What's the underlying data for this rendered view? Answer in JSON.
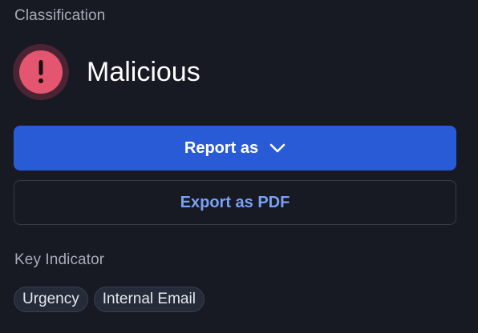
{
  "classification": {
    "label": "Classification",
    "value": "Malicious",
    "icon": "alert-circle-icon",
    "status_color": "#e4566f"
  },
  "actions": {
    "report_label": "Report as",
    "report_icon": "chevron-down-icon",
    "export_label": "Export as PDF"
  },
  "key_indicator": {
    "label": "Key Indicator",
    "tags": [
      "Urgency",
      "Internal Email"
    ]
  },
  "colors": {
    "background": "#171923",
    "primary": "#2a5bd7",
    "link": "#7aa1f5",
    "danger": "#e4566f"
  }
}
